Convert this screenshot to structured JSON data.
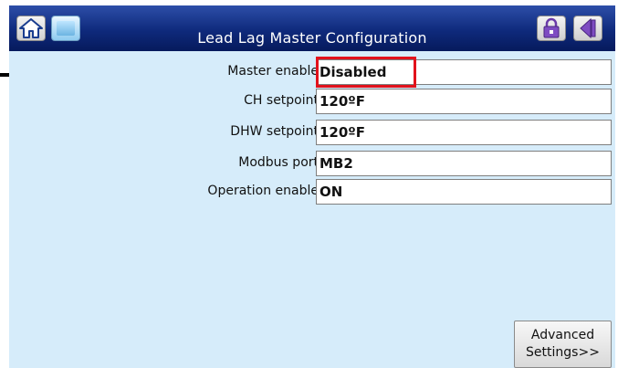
{
  "window": {
    "title": "Lead Lag Master Configuration"
  },
  "toolbar": {
    "home_icon": "home-icon",
    "screen_icon": "screen-icon",
    "lock_icon": "lock-icon",
    "back_icon": "back-icon"
  },
  "fields": [
    {
      "label": "Master enable",
      "value": "Disabled"
    },
    {
      "label": "CH setpoint",
      "value": "120ºF"
    },
    {
      "label": "DHW setpoint",
      "value": "120ºF"
    },
    {
      "label": "Modbus port",
      "value": "MB2"
    },
    {
      "label": "Operation enable",
      "value": "ON"
    }
  ],
  "advanced": {
    "line1": "Advanced",
    "line2": "Settings>>"
  },
  "colors": {
    "titlebar": "#0f2a7c",
    "screen_bg": "#d6ecfa",
    "highlight": "#e2121c",
    "arrow": "#000000"
  }
}
